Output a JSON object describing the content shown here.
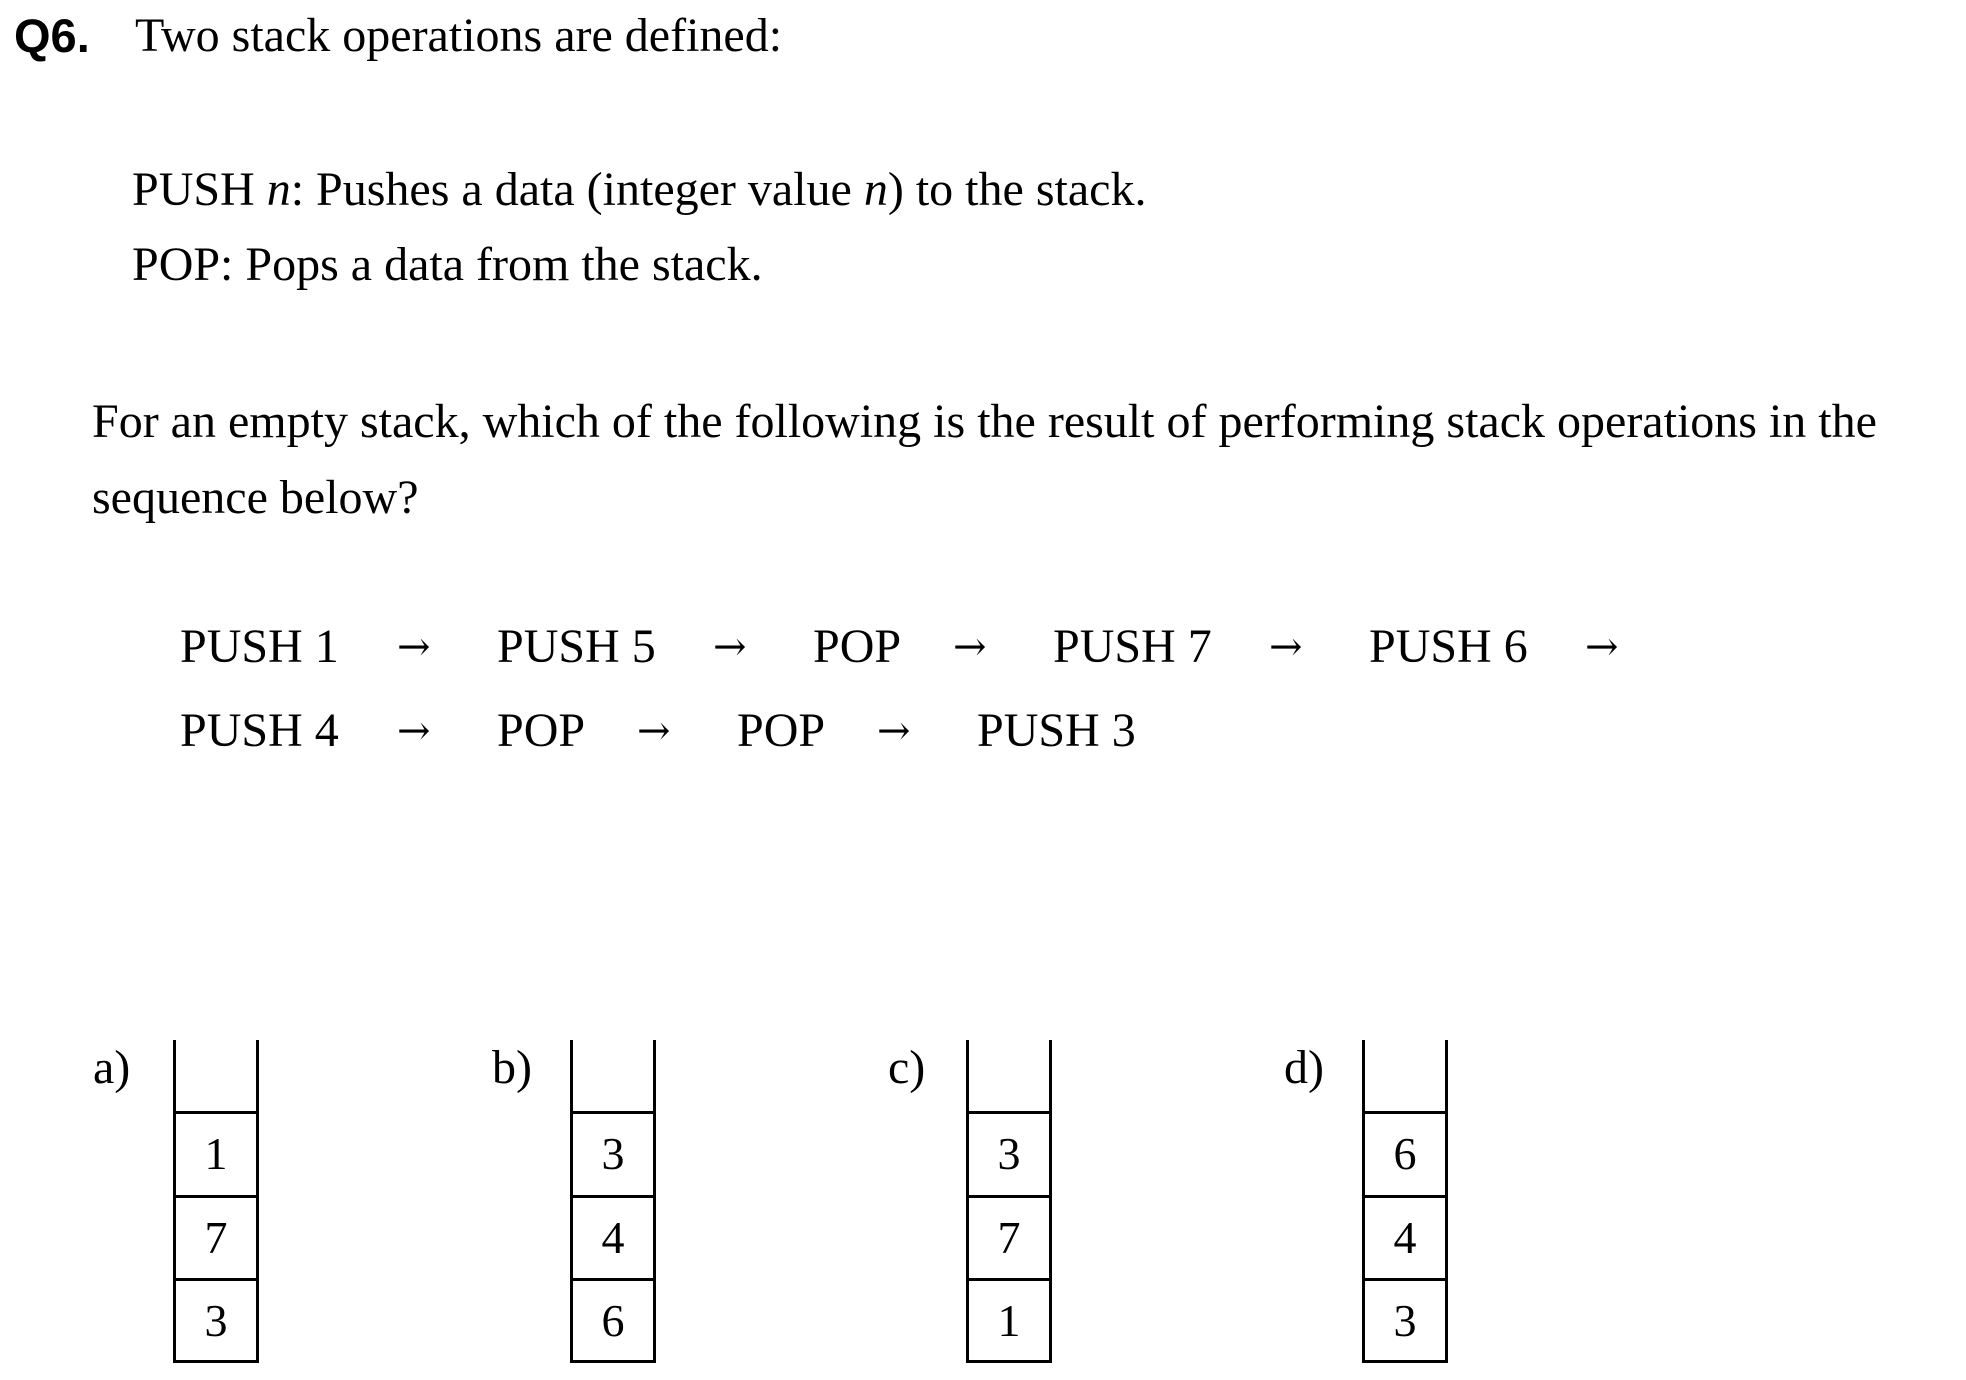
{
  "question": {
    "number": "Q6.",
    "title": "Two stack operations are defined:",
    "definitions": [
      {
        "term": "PUSH ",
        "var": "n",
        "text_a": ": Pushes a data (integer value ",
        "var2": "n",
        "text_b": ") to the stack."
      },
      {
        "text": "POP: Pops a data from the stack."
      }
    ],
    "prompt": "For an empty stack, which of the following is the result of performing stack operations in the sequence below?",
    "arrow": "→",
    "sequence_row1": [
      "PUSH 1",
      "PUSH 5",
      "POP",
      "PUSH 7",
      "PUSH 6"
    ],
    "sequence_row2": [
      "PUSH 4",
      "POP",
      "POP",
      "PUSH 3"
    ]
  },
  "choices": [
    {
      "label": "a)",
      "cells": [
        "1",
        "7",
        "3"
      ]
    },
    {
      "label": "b)",
      "cells": [
        "3",
        "4",
        "6"
      ]
    },
    {
      "label": "c)",
      "cells": [
        "3",
        "7",
        "1"
      ]
    },
    {
      "label": "d)",
      "cells": [
        "6",
        "4",
        "3"
      ]
    }
  ]
}
